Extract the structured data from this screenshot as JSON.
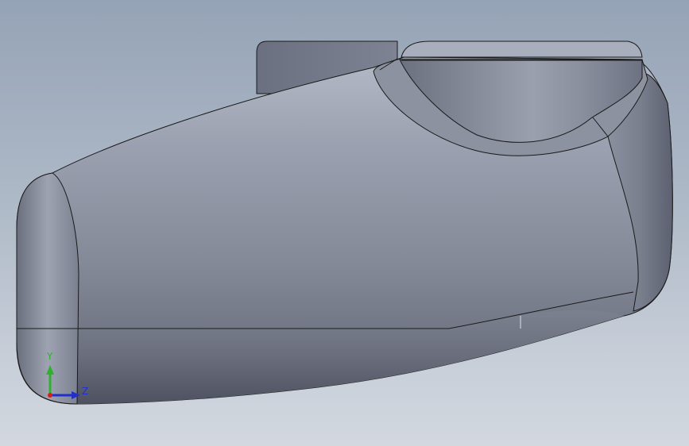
{
  "viewport": {
    "background_top": "#95a3b6",
    "background_bottom": "#d3d8df",
    "model_color": "#8a8f9e",
    "edge_color": "#1a1a1a"
  },
  "triad": {
    "y_label": "Y",
    "z_label": "Z",
    "y_color": "#2fb02f",
    "z_color": "#2030c8",
    "x_color": "#d02020"
  }
}
